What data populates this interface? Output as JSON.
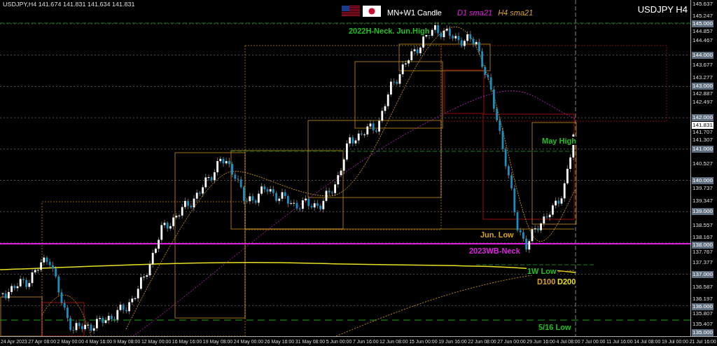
{
  "header": {
    "symbol_info": "USDJPY,H4  141.674 141.831 141.634 141.831",
    "title": "MN+W1 Candle",
    "symbol_title": "USDJPY H4"
  },
  "legend": [
    {
      "text": "D1 sma21",
      "color": "#e020e0"
    },
    {
      "text": "H4 sma21",
      "color": "#d9a020"
    }
  ],
  "labels": [
    {
      "text": "2022H-Neck. Jun.High",
      "color": "#1fc01f"
    },
    {
      "text": "May High",
      "color": "#1fc01f"
    },
    {
      "text": "Jun. Low",
      "color": "#d9a020"
    },
    {
      "text": "2023WB-Neck",
      "color": "#e020e0"
    },
    {
      "text": "1W Low",
      "color": "#1fc01f"
    },
    {
      "text": "D100",
      "color": "#d9a020"
    },
    {
      "text": "D200",
      "color": "#e8e020"
    },
    {
      "text": "5/16 Low",
      "color": "#1fc01f"
    }
  ],
  "price_axis": [
    {
      "text": "145.637",
      "kind": "tick"
    },
    {
      "text": "145.247",
      "kind": "tick"
    },
    {
      "text": "145.000",
      "kind": "level"
    },
    {
      "text": "144.857",
      "kind": "tick"
    },
    {
      "text": "144.467",
      "kind": "tick"
    },
    {
      "text": "144.000",
      "kind": "level"
    },
    {
      "text": "143.677",
      "kind": "tick"
    },
    {
      "text": "143.277",
      "kind": "tick"
    },
    {
      "text": "143.000",
      "kind": "level"
    },
    {
      "text": "142.887",
      "kind": "tick"
    },
    {
      "text": "142.497",
      "kind": "tick"
    },
    {
      "text": "142.000",
      "kind": "level"
    },
    {
      "text": "141.831",
      "kind": "current"
    },
    {
      "text": "141.707",
      "kind": "tick"
    },
    {
      "text": "141.307",
      "kind": "tick"
    },
    {
      "text": "141.000",
      "kind": "level"
    },
    {
      "text": "140.527",
      "kind": "tick"
    },
    {
      "text": "140.000",
      "kind": "level"
    },
    {
      "text": "139.737",
      "kind": "tick"
    },
    {
      "text": "139.347",
      "kind": "tick"
    },
    {
      "text": "139.000",
      "kind": "level"
    },
    {
      "text": "138.557",
      "kind": "tick"
    },
    {
      "text": "138.167",
      "kind": "tick"
    },
    {
      "text": "138.000",
      "kind": "level"
    },
    {
      "text": "137.767",
      "kind": "tick"
    },
    {
      "text": "137.377",
      "kind": "tick"
    },
    {
      "text": "137.000",
      "kind": "level"
    },
    {
      "text": "136.587",
      "kind": "tick"
    },
    {
      "text": "136.197",
      "kind": "tick"
    },
    {
      "text": "136.000",
      "kind": "level"
    },
    {
      "text": "135.807",
      "kind": "tick"
    },
    {
      "text": "135.407",
      "kind": "tick"
    },
    {
      "text": "135.000",
      "kind": "level"
    }
  ],
  "time_axis": [
    "24 Apr 2023",
    "27 Apr 08:00",
    "2 May 00:00",
    "4 May 16:00",
    "9 May 08:00",
    "12 May 00:00",
    "16 May 16:00",
    "19 May 08:00",
    "24 May 00:00",
    "26 May 16:00",
    "31 May 08:00",
    "5 Jun 00:00",
    "7 Jun 16:00",
    "12 Jun 08:00",
    "15 Jun 00:00",
    "19 Jun 16:00",
    "22 Jun 08:00",
    "27 Jun 00:00",
    "29 Jun 16:00",
    "4 Jul 08:00",
    "7 Jul 00:00",
    "11 Jul 16:00",
    "14 Jul 08:00",
    "19 Jul 00:00",
    "21 Jul 16:00"
  ]
}
